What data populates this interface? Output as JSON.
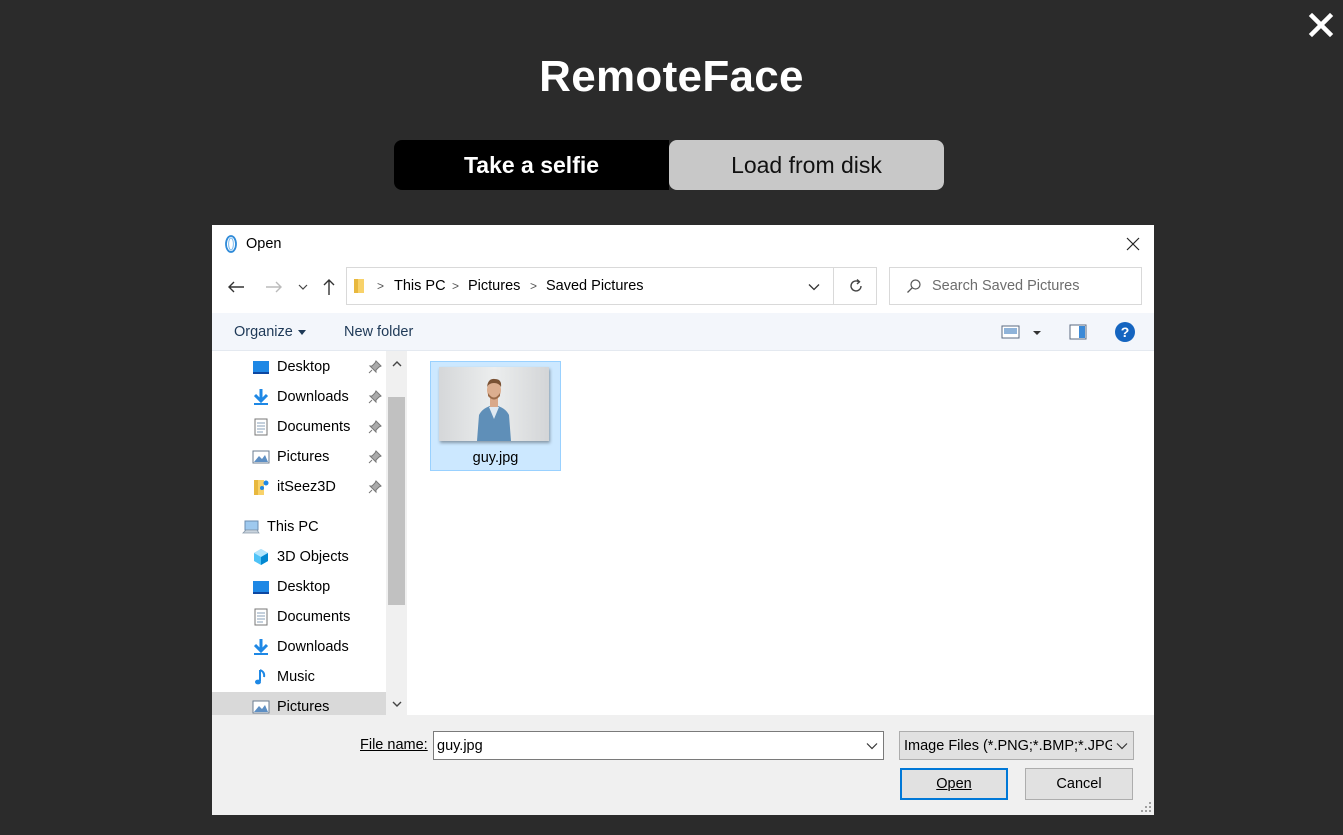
{
  "app": {
    "title": "RemoteFace",
    "close_icon": "close-icon",
    "tabs": [
      {
        "label": "Take a selfie",
        "active": true
      },
      {
        "label": "Load from disk",
        "active": false
      }
    ]
  },
  "dialog": {
    "title": "Open",
    "address": {
      "crumbs": [
        "This PC",
        "Pictures",
        "Saved Pictures"
      ]
    },
    "search": {
      "placeholder": "Search Saved Pictures",
      "value": ""
    },
    "commands": {
      "organize": "Organize",
      "new_folder": "New folder"
    },
    "nav": {
      "quick_access": [
        {
          "label": "Desktop",
          "icon": "desktop-icon",
          "pinned": true
        },
        {
          "label": "Downloads",
          "icon": "downloads-icon",
          "pinned": true
        },
        {
          "label": "Documents",
          "icon": "documents-icon",
          "pinned": true
        },
        {
          "label": "Pictures",
          "icon": "pictures-icon",
          "pinned": true
        },
        {
          "label": "itSeez3D",
          "icon": "folder-icon",
          "pinned": true
        }
      ],
      "this_pc": {
        "label": "This PC",
        "items": [
          {
            "label": "3D Objects",
            "icon": "3d-objects-icon"
          },
          {
            "label": "Desktop",
            "icon": "desktop-icon"
          },
          {
            "label": "Documents",
            "icon": "documents-icon"
          },
          {
            "label": "Downloads",
            "icon": "downloads-icon"
          },
          {
            "label": "Music",
            "icon": "music-icon"
          },
          {
            "label": "Pictures",
            "icon": "pictures-icon",
            "selected": true
          }
        ]
      }
    },
    "files": [
      {
        "name": "guy.jpg",
        "selected": true
      }
    ],
    "file_name": {
      "label": "File name:",
      "value": "guy.jpg"
    },
    "file_type": {
      "value": "Image Files (*.PNG;*.BMP;*.JPG;*"
    },
    "buttons": {
      "open": "Open",
      "cancel": "Cancel"
    }
  },
  "colors": {
    "background": "#2b2b2b",
    "accent": "#0078d7",
    "selection": "#cce8ff"
  }
}
